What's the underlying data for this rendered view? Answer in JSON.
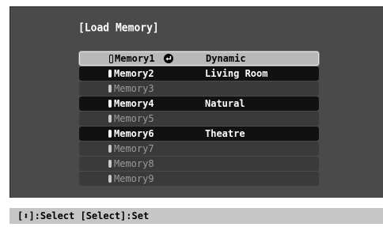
{
  "title": "[Load Memory]",
  "memories": [
    {
      "name": "Memory1",
      "desc": "Dynamic",
      "state": "selected"
    },
    {
      "name": "Memory2",
      "desc": "Living Room",
      "state": "filled"
    },
    {
      "name": "Memory3",
      "desc": "",
      "state": "empty"
    },
    {
      "name": "Memory4",
      "desc": "Natural",
      "state": "filled"
    },
    {
      "name": "Memory5",
      "desc": "",
      "state": "empty"
    },
    {
      "name": "Memory6",
      "desc": "Theatre",
      "state": "filled"
    },
    {
      "name": "Memory7",
      "desc": "",
      "state": "empty"
    },
    {
      "name": "Memory8",
      "desc": "",
      "state": "empty"
    },
    {
      "name": "Memory9",
      "desc": "",
      "state": "empty"
    }
  ],
  "footer": {
    "hint": "[⬍]:Select [Select]:Set"
  },
  "icons": {
    "selected_row": "enter-icon",
    "slot_marker": "memory-slot-marker"
  },
  "colors": {
    "menu_background": "#4a4a4a",
    "row_filled": "#111111",
    "row_empty": "#3a3a3a",
    "row_selected": "#b8b8b8",
    "footer_background": "#c6c6c6"
  }
}
